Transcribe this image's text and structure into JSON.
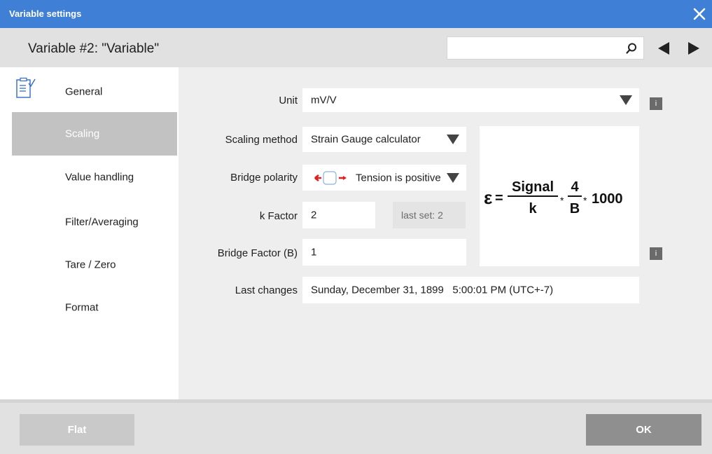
{
  "window": {
    "title": "Variable settings"
  },
  "header": {
    "variable_title": "Variable #2: \"Variable\"",
    "search_value": ""
  },
  "sidebar": {
    "items": [
      {
        "label": "General"
      },
      {
        "label": "Scaling"
      },
      {
        "label": "Value handling"
      },
      {
        "label": "Filter/Averaging"
      },
      {
        "label": "Tare / Zero"
      },
      {
        "label": "Format"
      }
    ],
    "active": "Scaling"
  },
  "form": {
    "unit": {
      "label": "Unit",
      "value": "mV/V"
    },
    "scaling_method": {
      "label": "Scaling method",
      "value": "Strain Gauge calculator"
    },
    "bridge_polarity": {
      "label": "Bridge polarity",
      "value": "Tension is positive"
    },
    "k_factor": {
      "label": "k Factor",
      "value": "2",
      "last_set": "last set: 2"
    },
    "bridge_factor": {
      "label": "Bridge Factor (B)",
      "value": "1"
    },
    "last_changes": {
      "label": "Last changes",
      "value": "Sunday, December 31, 1899   5:00:01 PM (UTC+-7)"
    },
    "info_label": "i"
  },
  "formula": {
    "epsilon": "ε",
    "equals": "=",
    "numerator1": "Signal",
    "denominator1": "k",
    "times": "*",
    "numerator2": "4",
    "denominator2": "B",
    "constant": "1000"
  },
  "footer": {
    "flat_label": "Flat",
    "ok_label": "OK"
  },
  "colors": {
    "titlebar": "#3f7fd6",
    "header": "#e1e1e1",
    "active_item": "#c2c2c2",
    "main_bg": "#eeeeee",
    "ok_button": "#8f8f8f",
    "polarity_arrows": "#e02020"
  },
  "icons": {
    "close": "close-icon",
    "search": "search-icon",
    "prev": "arrow-left-icon",
    "next": "arrow-right-icon",
    "general": "document-check-icon"
  }
}
